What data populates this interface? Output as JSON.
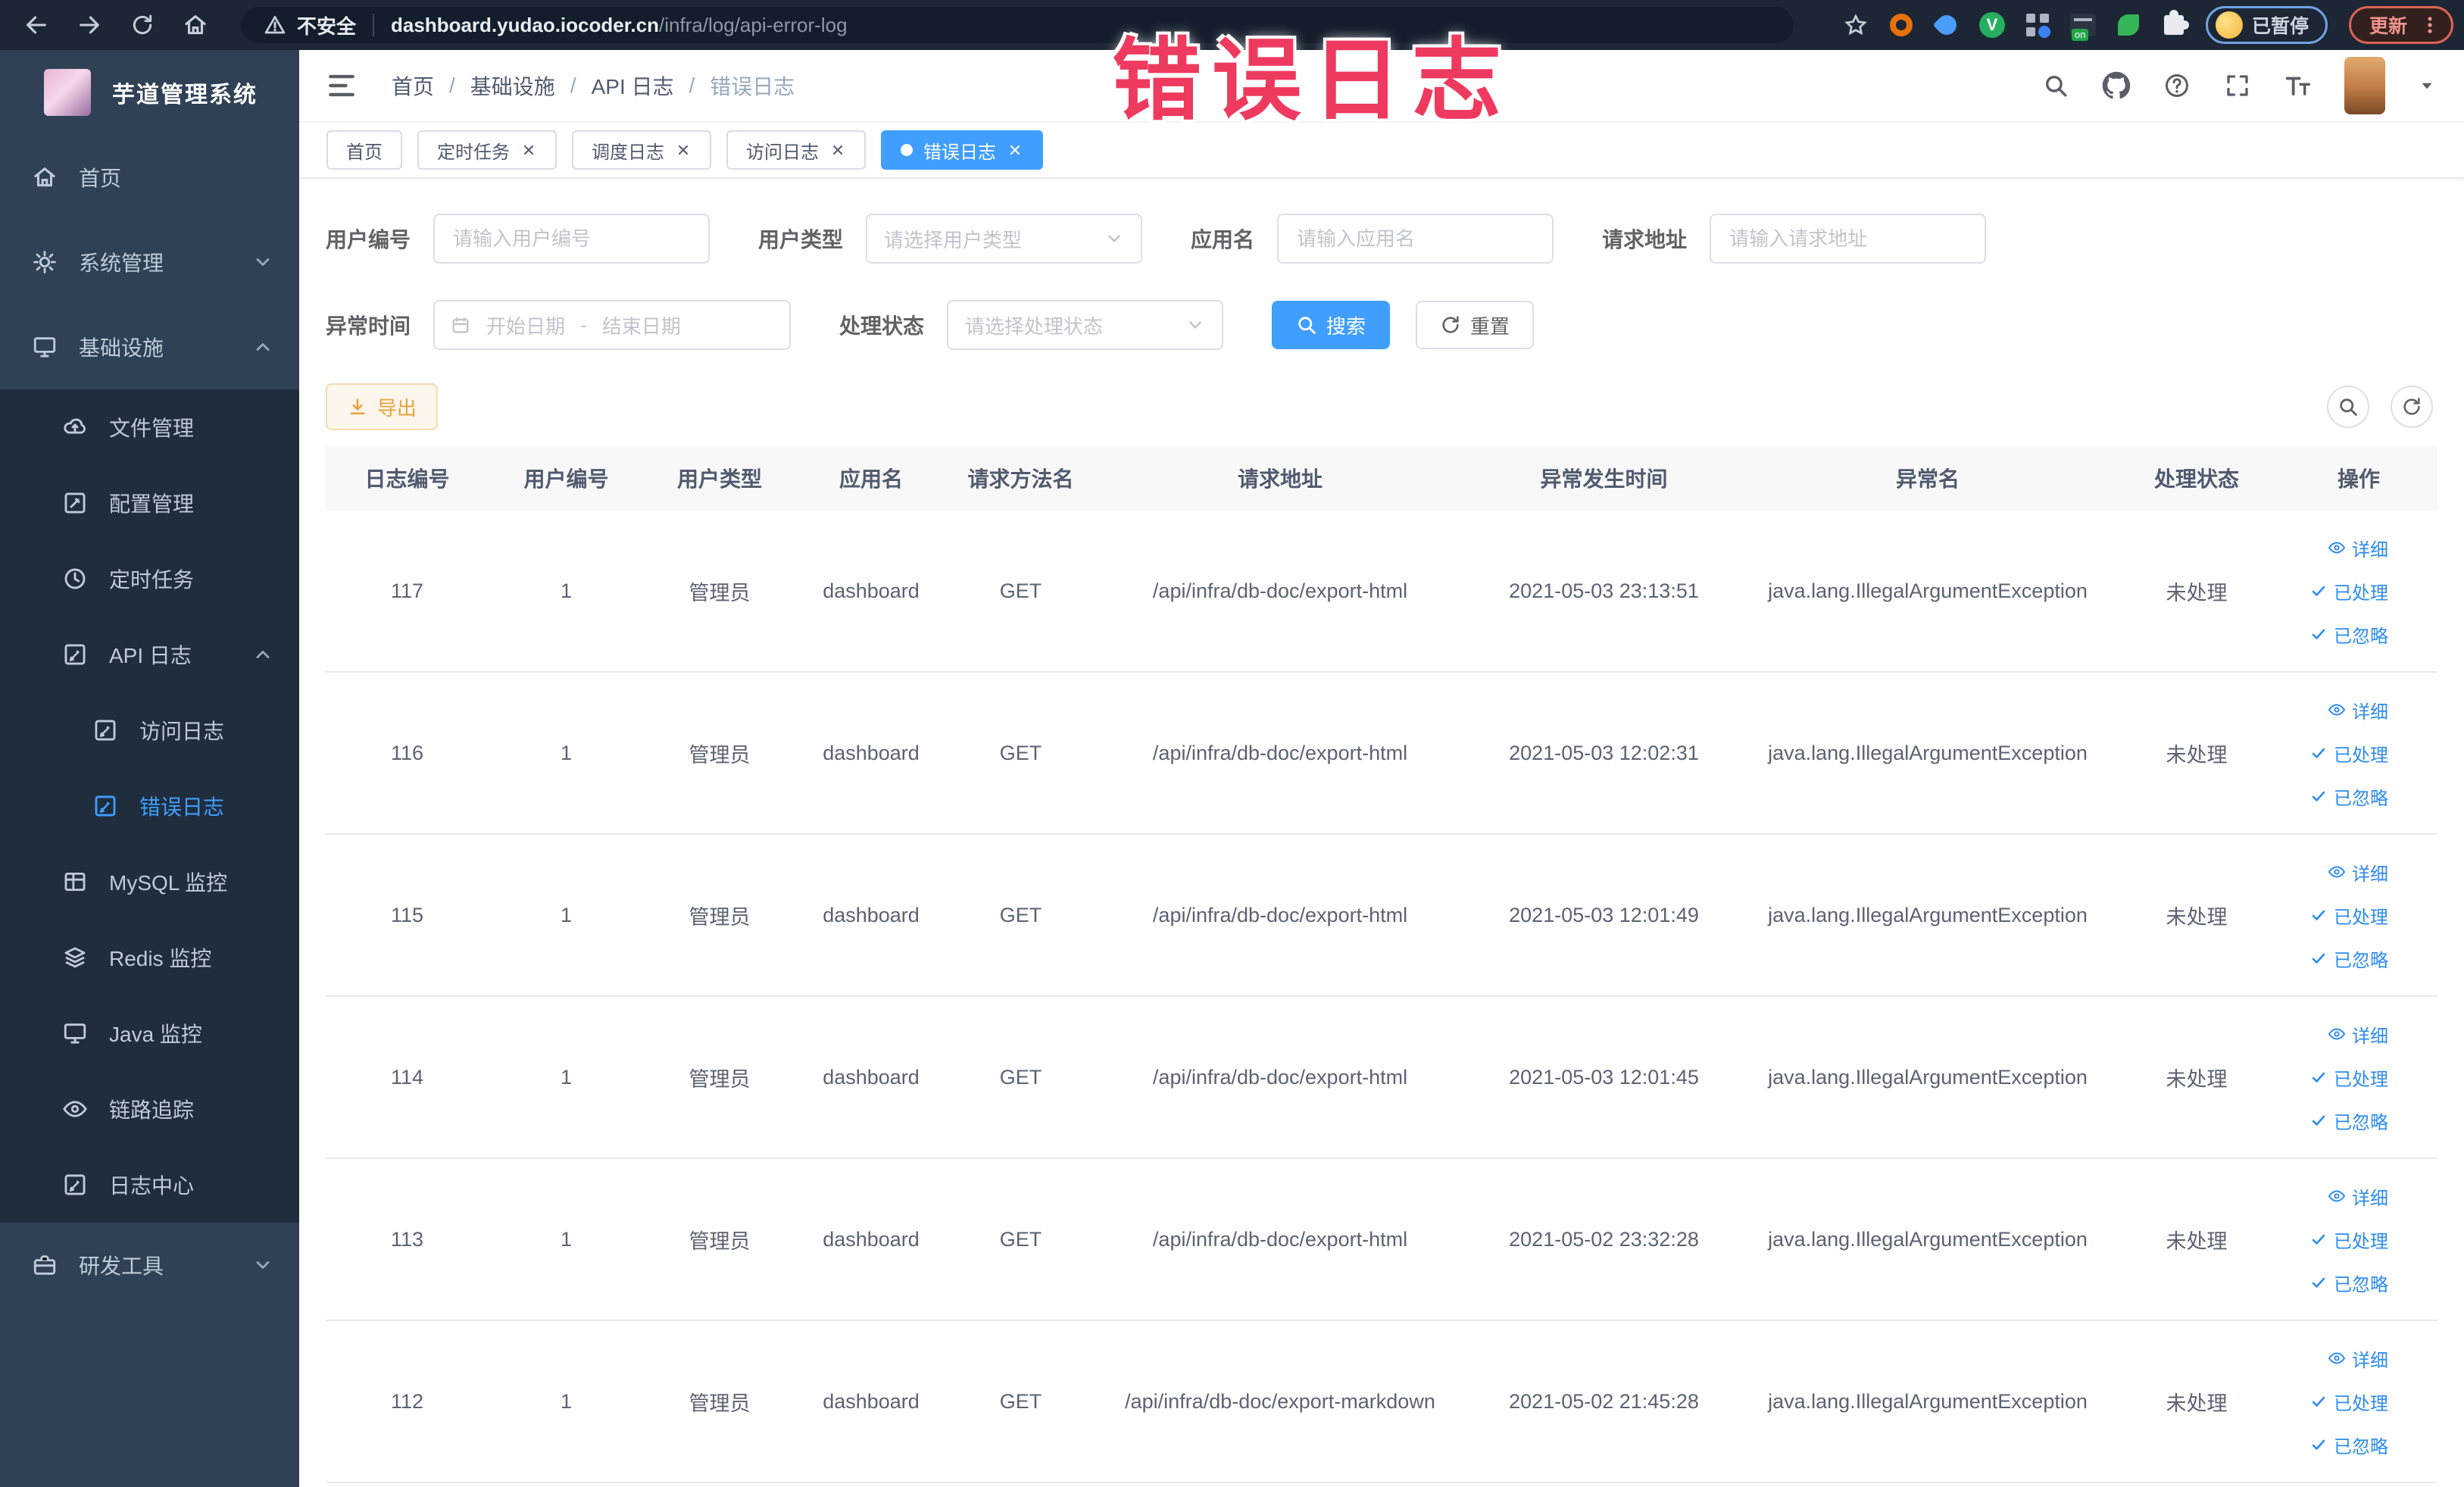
{
  "annotation": {
    "title": "错误日志"
  },
  "browser": {
    "security_label": "不安全",
    "url_domain": "dashboard.yudao.iocoder.cn",
    "url_path": "/infra/log/api-error-log",
    "paused_badge": "已暂停",
    "update_button": "更新"
  },
  "sidebar": {
    "logo_title": "芋道管理系统",
    "items": [
      {
        "label": "首页"
      },
      {
        "label": "系统管理"
      },
      {
        "label": "基础设施"
      },
      {
        "label": "文件管理"
      },
      {
        "label": "配置管理"
      },
      {
        "label": "定时任务"
      },
      {
        "label": "API 日志"
      },
      {
        "label": "访问日志"
      },
      {
        "label": "错误日志"
      },
      {
        "label": "MySQL 监控"
      },
      {
        "label": "Redis 监控"
      },
      {
        "label": "Java 监控"
      },
      {
        "label": "链路追踪"
      },
      {
        "label": "日志中心"
      },
      {
        "label": "研发工具"
      }
    ]
  },
  "breadcrumb": {
    "separator": "/",
    "items": [
      "首页",
      "基础设施",
      "API 日志",
      "错误日志"
    ]
  },
  "tabs": [
    {
      "label": "首页"
    },
    {
      "label": "定时任务"
    },
    {
      "label": "调度日志"
    },
    {
      "label": "访问日志"
    },
    {
      "label": "错误日志"
    }
  ],
  "filters": {
    "user_id": {
      "label": "用户编号",
      "placeholder": "请输入用户编号"
    },
    "user_type": {
      "label": "用户类型",
      "placeholder": "请选择用户类型"
    },
    "app_name": {
      "label": "应用名",
      "placeholder": "请输入应用名"
    },
    "request_url": {
      "label": "请求地址",
      "placeholder": "请输入请求地址"
    },
    "exception_time": {
      "label": "异常时间",
      "start_placeholder": "开始日期",
      "separator": "-",
      "end_placeholder": "结束日期"
    },
    "process_status": {
      "label": "处理状态",
      "placeholder": "请选择处理状态"
    },
    "search_button": "搜索",
    "reset_button": "重置"
  },
  "toolbar": {
    "export_button": "导出"
  },
  "table": {
    "columns": [
      "日志编号",
      "用户编号",
      "用户类型",
      "应用名",
      "请求方法名",
      "请求地址",
      "异常发生时间",
      "异常名",
      "处理状态",
      "操作"
    ],
    "actions": {
      "detail": "详细",
      "processed": "已处理",
      "ignored": "已忽略"
    },
    "rows": [
      {
        "log_id": "117",
        "user_id": "1",
        "user_type": "管理员",
        "app_name": "dashboard",
        "method": "GET",
        "url": "/api/infra/db-doc/export-html",
        "time": "2021-05-03 23:13:51",
        "exception": "java.lang.IllegalArgumentException",
        "status": "未处理"
      },
      {
        "log_id": "116",
        "user_id": "1",
        "user_type": "管理员",
        "app_name": "dashboard",
        "method": "GET",
        "url": "/api/infra/db-doc/export-html",
        "time": "2021-05-03 12:02:31",
        "exception": "java.lang.IllegalArgumentException",
        "status": "未处理"
      },
      {
        "log_id": "115",
        "user_id": "1",
        "user_type": "管理员",
        "app_name": "dashboard",
        "method": "GET",
        "url": "/api/infra/db-doc/export-html",
        "time": "2021-05-03 12:01:49",
        "exception": "java.lang.IllegalArgumentException",
        "status": "未处理"
      },
      {
        "log_id": "114",
        "user_id": "1",
        "user_type": "管理员",
        "app_name": "dashboard",
        "method": "GET",
        "url": "/api/infra/db-doc/export-html",
        "time": "2021-05-03 12:01:45",
        "exception": "java.lang.IllegalArgumentException",
        "status": "未处理"
      },
      {
        "log_id": "113",
        "user_id": "1",
        "user_type": "管理员",
        "app_name": "dashboard",
        "method": "GET",
        "url": "/api/infra/db-doc/export-html",
        "time": "2021-05-02 23:32:28",
        "exception": "java.lang.IllegalArgumentException",
        "status": "未处理"
      },
      {
        "log_id": "112",
        "user_id": "1",
        "user_type": "管理员",
        "app_name": "dashboard",
        "method": "GET",
        "url": "/api/infra/db-doc/export-markdown",
        "time": "2021-05-02 21:45:28",
        "exception": "java.lang.IllegalArgumentException",
        "status": "未处理"
      }
    ]
  },
  "colors": {
    "primary": "#409eff",
    "link": "#2d8cf0",
    "warning": "#e6a23c",
    "sidebar_bg": "#304156",
    "submenu_bg": "#1f2d3d",
    "chrome_bg": "#1d2634",
    "annotation": "#ee3a5f"
  }
}
